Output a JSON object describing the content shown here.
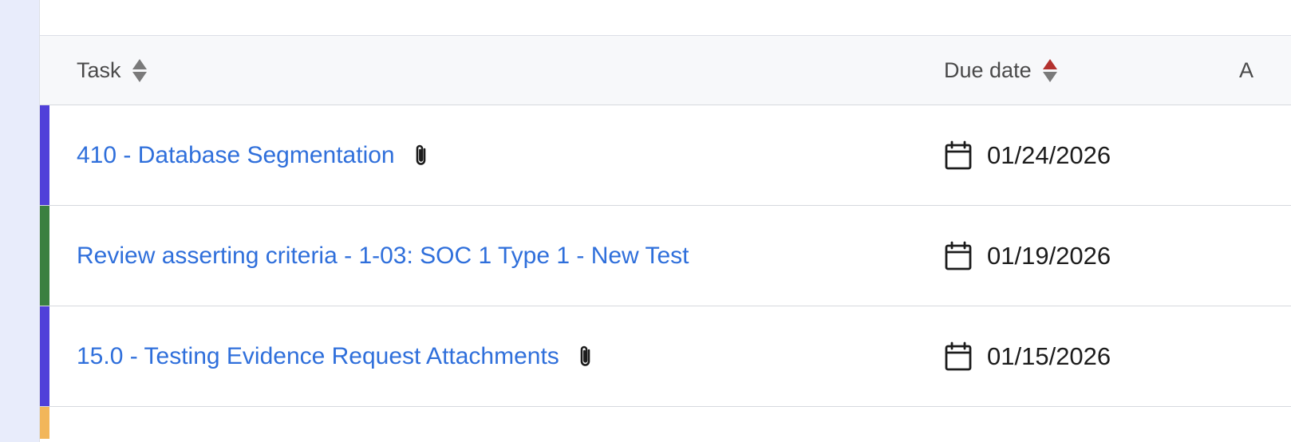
{
  "table": {
    "columns": {
      "task": "Task",
      "due_date": "Due date",
      "third": "A"
    },
    "rows": [
      {
        "task": "410 - Database Segmentation",
        "has_attachment": true,
        "due": "01/24/2026",
        "accent": "#5040d9"
      },
      {
        "task": "Review asserting criteria - 1-03: SOC 1 Type 1 - New Test",
        "has_attachment": false,
        "due": "01/19/2026",
        "accent": "#3a8040"
      },
      {
        "task": "15.0 - Testing Evidence Request Attachments",
        "has_attachment": true,
        "due": "01/15/2026",
        "accent": "#5040d9"
      }
    ],
    "partial_row_accent": "#f2b65a"
  },
  "icons": {
    "sort": "sort-icon",
    "attachment": "paperclip-icon",
    "calendar": "calendar-icon"
  },
  "colors": {
    "link": "#2f6fdb",
    "sort_active": "#b3312e"
  }
}
